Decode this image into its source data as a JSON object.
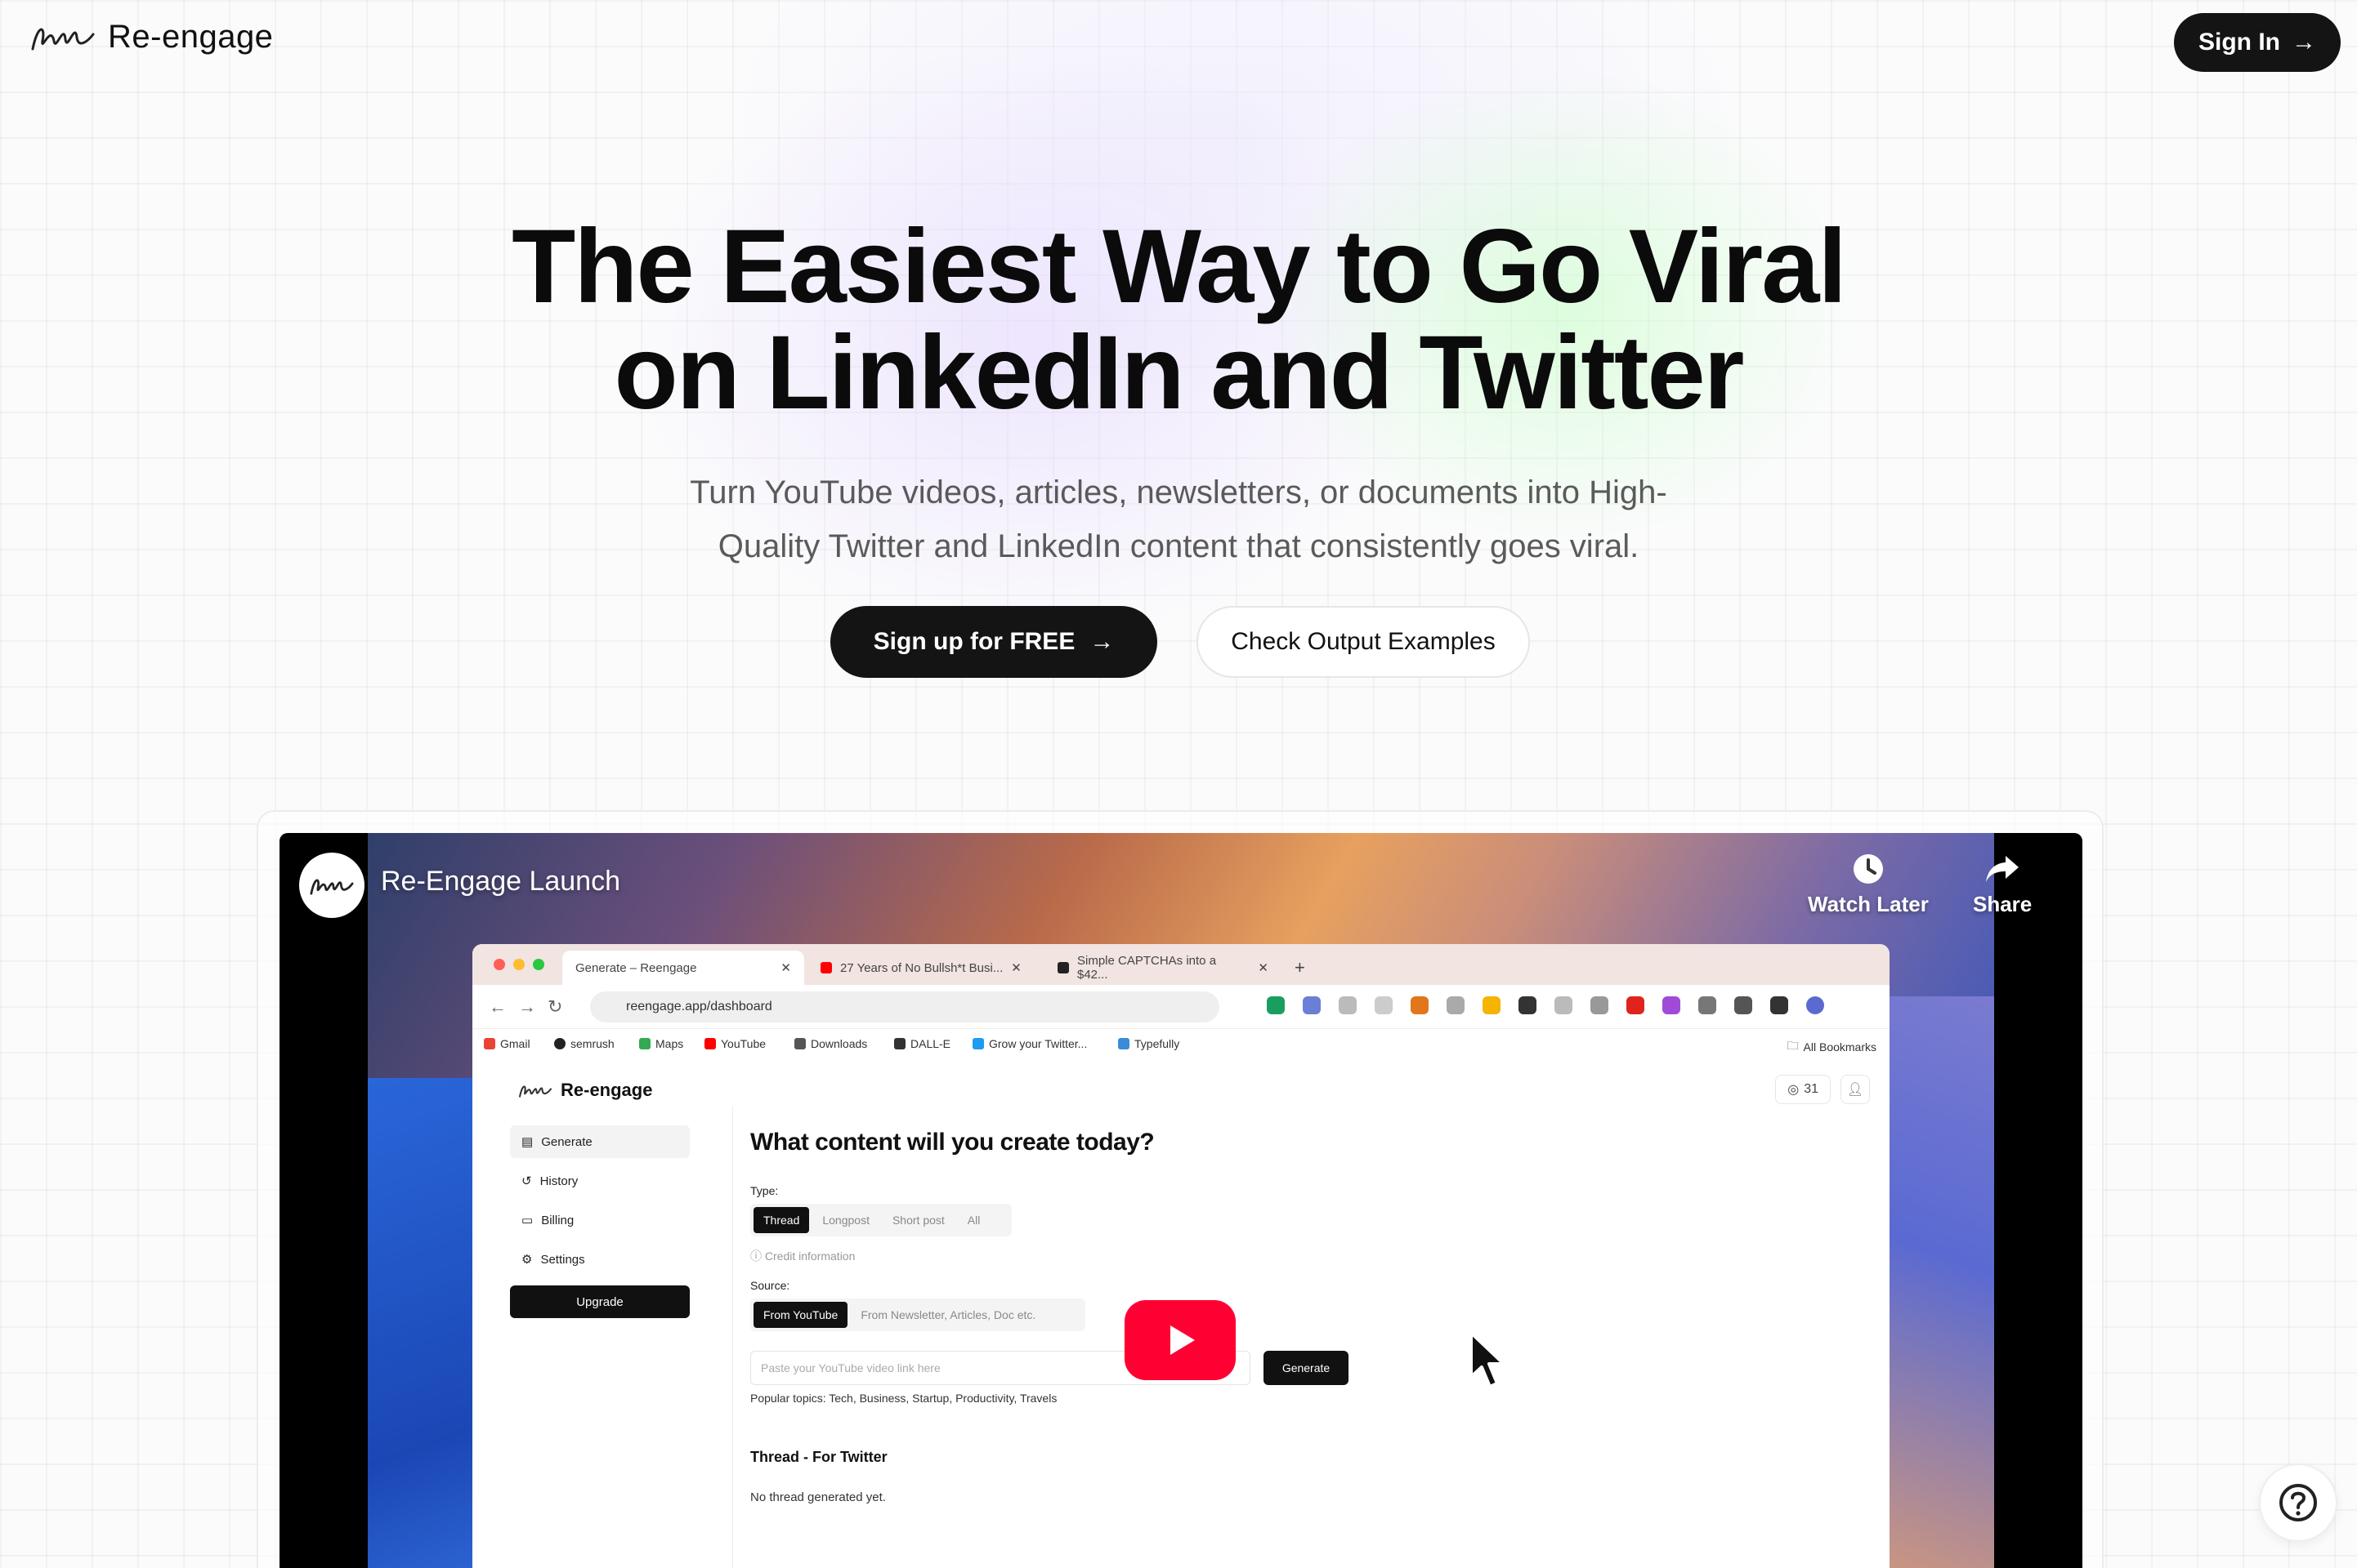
{
  "header": {
    "brand": "Re-engage",
    "sign_in_label": "Sign In",
    "arrow": "→"
  },
  "hero": {
    "headline_line1": "The Easiest Way to Go Viral",
    "headline_line2": "on LinkedIn and Twitter",
    "subtext_line1": "Turn YouTube videos, articles, newsletters, or documents into High-",
    "subtext_line2": "Quality Twitter and LinkedIn content that consistently goes viral.",
    "primary_cta": "Sign up for FREE",
    "secondary_cta": "Check Output Examples"
  },
  "video": {
    "title": "Re-Engage Launch",
    "watch_later": "Watch Later",
    "share": "Share",
    "browser": {
      "tabs": [
        "Generate – Reengage",
        "27 Years of No Bullsh*t Busi...",
        "Simple CAPTCHAs into a $42..."
      ],
      "url": "reengage.app/dashboard",
      "bookmarks": [
        "Gmail",
        "semrush",
        "Maps",
        "YouTube",
        "Downloads",
        "DALL-E",
        "Grow your Twitter...",
        "Typefully"
      ],
      "all_bookmarks": "All Bookmarks"
    },
    "app": {
      "brand": "Re-engage",
      "credits": "31",
      "sidebar": [
        "Generate",
        "History",
        "Billing",
        "Settings"
      ],
      "upgrade": "Upgrade",
      "heading": "What content will you create today?",
      "type_label": "Type:",
      "types": [
        "Thread",
        "Longpost",
        "Short post",
        "All"
      ],
      "credit_info": "Credit information",
      "source_label": "Source:",
      "sources": [
        "From YouTube",
        "From Newsletter, Articles, Doc etc."
      ],
      "input_placeholder": "Paste your YouTube video link here",
      "generate": "Generate",
      "topics": "Popular topics: Tech, Business, Startup, Productivity, Travels",
      "thread_heading": "Thread - For Twitter",
      "no_thread": "No thread generated yet."
    }
  },
  "colors": {
    "dark": "#141414",
    "youtube_red": "#ff0033"
  }
}
